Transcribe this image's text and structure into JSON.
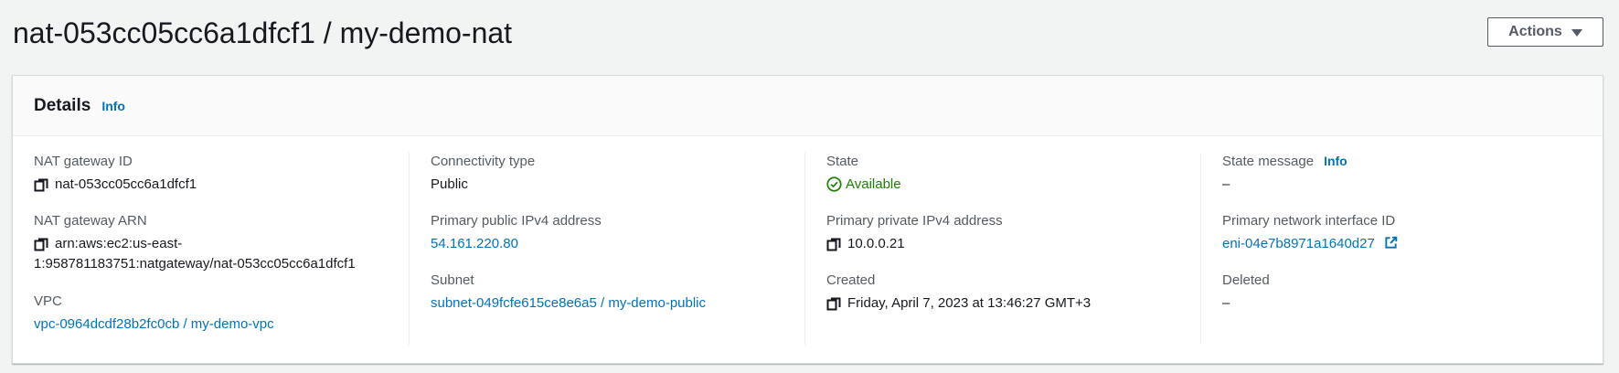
{
  "page": {
    "title": "nat-053cc05cc6a1dfcf1 / my-demo-nat",
    "actions_label": "Actions"
  },
  "details": {
    "title": "Details",
    "info_label": "Info",
    "nat_gateway_id": {
      "label": "NAT gateway ID",
      "value": "nat-053cc05cc6a1dfcf1"
    },
    "nat_gateway_arn": {
      "label": "NAT gateway ARN",
      "value_line1": "arn:aws:ec2:us-east-",
      "value_line2": "1:958781183751:natgateway/nat-053cc05cc6a1dfcf1"
    },
    "vpc": {
      "label": "VPC",
      "value": "vpc-0964dcdf28b2fc0cb / my-demo-vpc"
    },
    "connectivity_type": {
      "label": "Connectivity type",
      "value": "Public"
    },
    "primary_public_ipv4": {
      "label": "Primary public IPv4 address",
      "value": "54.161.220.80"
    },
    "subnet": {
      "label": "Subnet",
      "value": "subnet-049fcfe615ce8e6a5 / my-demo-public"
    },
    "state": {
      "label": "State",
      "value": "Available"
    },
    "primary_private_ipv4": {
      "label": "Primary private IPv4 address",
      "value": "10.0.0.21"
    },
    "created": {
      "label": "Created",
      "value": "Friday, April 7, 2023 at 13:46:27 GMT+3"
    },
    "state_message": {
      "label": "State message",
      "info_label": "Info",
      "value": "–"
    },
    "primary_network_interface": {
      "label": "Primary network interface ID",
      "value": "eni-04e7b8971a1640d27"
    },
    "deleted": {
      "label": "Deleted",
      "value": "–"
    }
  },
  "icons": {
    "copy": "copy-icon",
    "check": "status-check-icon",
    "external": "external-link-icon",
    "caret": "caret-down-icon"
  },
  "colors": {
    "link": "#0073bb",
    "success": "#1d8102",
    "text": "#16191f",
    "label": "#545b64",
    "background": "#f2f3f3"
  }
}
